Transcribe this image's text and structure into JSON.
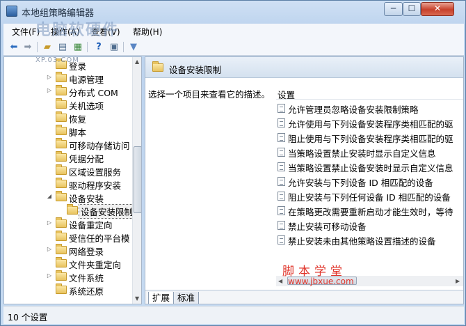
{
  "window": {
    "title": "本地组策略编辑器",
    "controls": {
      "minimize": "─",
      "maximize": "☐",
      "close": "✕"
    }
  },
  "menu": [
    "文件(F)",
    "操作(A)",
    "查看(V)",
    "帮助(H)"
  ],
  "toolbar": {
    "icons": [
      "back-arrow-icon",
      "forward-arrow-icon",
      "up-folder-icon",
      "show-hide-tree-icon",
      "export-list-icon",
      "help-icon",
      "properties-icon",
      "filter-icon"
    ]
  },
  "tree": {
    "items": [
      {
        "label": "登录",
        "arrow": ""
      },
      {
        "label": "电源管理",
        "arrow": "▷"
      },
      {
        "label": "分布式 COM",
        "arrow": "▷"
      },
      {
        "label": "关机选项",
        "arrow": ""
      },
      {
        "label": "恢复",
        "arrow": ""
      },
      {
        "label": "脚本",
        "arrow": ""
      },
      {
        "label": "可移动存储访问",
        "arrow": ""
      },
      {
        "label": "凭据分配",
        "arrow": ""
      },
      {
        "label": "区域设置服务",
        "arrow": ""
      },
      {
        "label": "驱动程序安装",
        "arrow": ""
      },
      {
        "label": "设备安装",
        "arrow": "◢"
      },
      {
        "label": "设备安装限制",
        "arrow": ""
      },
      {
        "label": "设备重定向",
        "arrow": "▷"
      },
      {
        "label": "受信任的平台模",
        "arrow": ""
      },
      {
        "label": "网络登录",
        "arrow": "▷"
      },
      {
        "label": "文件夹重定向",
        "arrow": ""
      },
      {
        "label": "文件系统",
        "arrow": "▷"
      },
      {
        "label": "系统还原",
        "arrow": ""
      }
    ]
  },
  "right": {
    "header_title": "设备安装限制",
    "description": "选择一个项目来查看它的描述。",
    "column_header": "设置",
    "settings": [
      "允许管理员忽略设备安装限制策略",
      "允许使用与下列设备安装程序类相匹配的驱",
      "阻止使用与下列设备安装程序类相匹配的驱",
      "当策略设置禁止安装时显示自定义信息",
      "当策略设置禁止设备安装时显示自定义信息",
      "允许安装与下列设备 ID 相匹配的设备",
      "阻止安装与下列任何设备 ID 相匹配的设备",
      "在策略更改需要重新启动才能生效时，等待",
      "禁止安装可移动设备",
      "禁止安装未由其他策略设置描述的设备"
    ],
    "tabs": [
      "扩展",
      "标准"
    ]
  },
  "status": "10 个设置",
  "watermarks": {
    "top": "电脑软硬件",
    "top_url": "XP.03.COM",
    "bottom": "脚本学堂",
    "bottom_url": "www.jbxue.com"
  }
}
